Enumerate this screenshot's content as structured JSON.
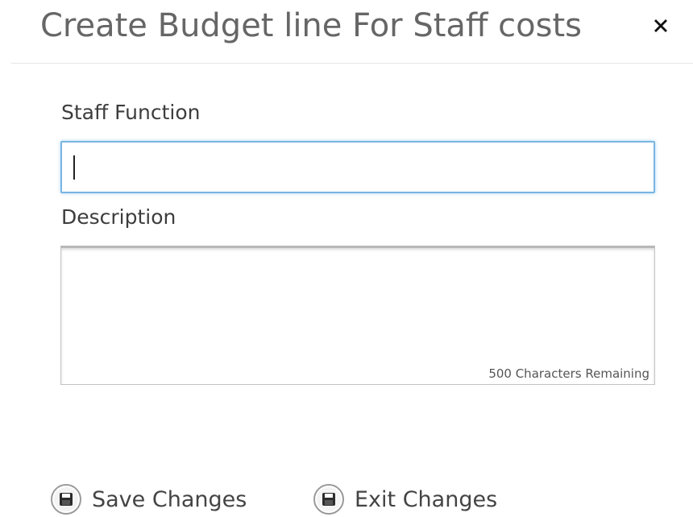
{
  "dialog": {
    "title": "Create Budget line For Staff costs",
    "close_icon": "close-icon"
  },
  "form": {
    "staff_function": {
      "label": "Staff Function",
      "value": ""
    },
    "description": {
      "label": "Description",
      "value": "",
      "char_counter": "500 Characters Remaining"
    }
  },
  "actions": {
    "save": {
      "label": "Save Changes",
      "icon": "floppy-disk-icon"
    },
    "exit": {
      "label": "Exit Changes",
      "icon": "floppy-disk-icon"
    }
  },
  "colors": {
    "input_focus_border": "#78b6e2",
    "title_text": "#666666"
  }
}
